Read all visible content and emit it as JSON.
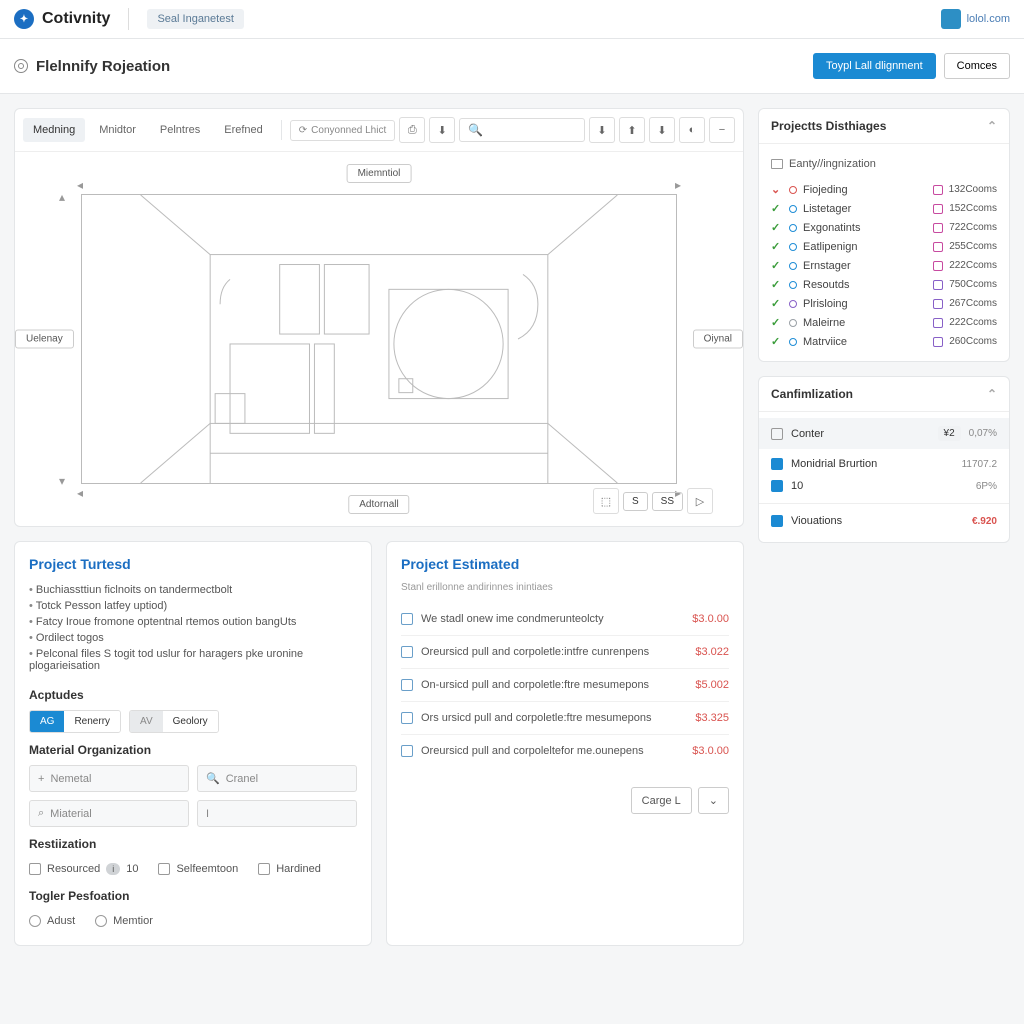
{
  "brand": {
    "name": "Cotivnity",
    "tag": "Seal Inganetest",
    "user": "lolol.com"
  },
  "page": {
    "title": "Flelnnify Rojeation",
    "primary_btn": "Toypl Lall dlignment",
    "secondary_btn": "Comces"
  },
  "tabs": [
    "Medning",
    "Mnidtor",
    "Pelntres",
    "Erefned"
  ],
  "toolbar": {
    "select_label": "Conyonned Lhict",
    "search_placeholder": ""
  },
  "canvas": {
    "top": "Miemntiol",
    "bottom": "Adtornall",
    "left": "Uelenay",
    "right": "Oiynal",
    "page_a": "S",
    "page_b": "SS"
  },
  "dist_panel": {
    "title": "Projectts Disthiages",
    "crumb": "Eanty//ingnization",
    "rows": [
      {
        "ok": false,
        "color": "#d9534f",
        "name": "Fiojeding",
        "badge": "#c74aa0",
        "val": "132Cooms"
      },
      {
        "ok": true,
        "color": "#1f8dd6",
        "name": "Listetager",
        "badge": "#c74aa0",
        "val": "152Ccoms"
      },
      {
        "ok": true,
        "color": "#1f8dd6",
        "name": "Exgonatints",
        "badge": "#c74aa0",
        "val": "722Ccoms"
      },
      {
        "ok": true,
        "color": "#1f8dd6",
        "name": "Eatlipenign",
        "badge": "#c74aa0",
        "val": "255Ccoms"
      },
      {
        "ok": true,
        "color": "#1f8dd6",
        "name": "Ernstager",
        "badge": "#c74aa0",
        "val": "222Ccoms"
      },
      {
        "ok": true,
        "color": "#1f8dd6",
        "name": "Resoutds",
        "badge": "#8860c7",
        "val": "750Ccoms"
      },
      {
        "ok": true,
        "color": "#8860c7",
        "name": "Plrisloing",
        "badge": "#8860c7",
        "val": "267Ccoms"
      },
      {
        "ok": true,
        "color": "#9aa0a6",
        "name": "Maleirne",
        "badge": "#8860c7",
        "val": "222Ccoms"
      },
      {
        "ok": true,
        "color": "#1f8dd6",
        "name": "Matrviice",
        "badge": "#8860c7",
        "val": "260Ccoms"
      }
    ]
  },
  "conf_panel": {
    "title": "Canfimlization",
    "rows": [
      {
        "on": false,
        "label": "Conter",
        "pill": "¥2",
        "val": "0,07%",
        "red": false
      },
      {
        "on": true,
        "label": "Monidrial Brurtion",
        "pill": "",
        "val": "11707.2",
        "red": false
      },
      {
        "on": true,
        "label": "10",
        "pill": "",
        "val": "6P%",
        "red": false
      },
      {
        "on": true,
        "label": "Viouations",
        "pill": "",
        "val": "€.920",
        "red": true
      }
    ]
  },
  "turted": {
    "title": "Project Turtesd",
    "bullets": [
      "Buchiassttiun ficlnoits on tandermectbolt",
      "Totck Pesson latfey uptiod)",
      "Fatcy Iroue fromone optentnal rtemos oution bangUts",
      "Ordilect togos",
      "Pelconal files S togit tod uslur for haragers pke uronine plogarieisation"
    ],
    "aptudes": "Acptudes",
    "chip_a1": "AG",
    "chip_a2": "Renerry",
    "chip_b1": "AV",
    "chip_b2": "Geolory",
    "mat_org": "Material Organization",
    "f_new": "Nemetal",
    "f_cranel": "Cranel",
    "f_mat": "Miaterial",
    "f_blank": "I",
    "rest": "Restiization",
    "opt1": "Resourced",
    "opt1_n": "10",
    "opt2": "Selfeemtoon",
    "opt3": "Hardined",
    "togler": "Togler Pesfoation",
    "r1": "Adust",
    "r2": "Memtior"
  },
  "est": {
    "title": "Project Estimated",
    "note": "Stanl erillonne andirinnes inintiaes",
    "rows": [
      {
        "t": "We stadl onew ime condmerunteolcty",
        "p": "$3.0.00"
      },
      {
        "t": "Oreursicd pull and corpoletle:intfre cunrenpens",
        "p": "$3.022"
      },
      {
        "t": "On-ursicd pull and corpoletle:ftre mesumepons",
        "p": "$5.002"
      },
      {
        "t": "Ors ursicd pull and corpoletle:ftre mesumepons",
        "p": "$3.325"
      },
      {
        "t": "Oreursicd pull and corpoleltefor me.ounepens",
        "p": "$3.0.00"
      }
    ],
    "footer": "Carge L"
  }
}
